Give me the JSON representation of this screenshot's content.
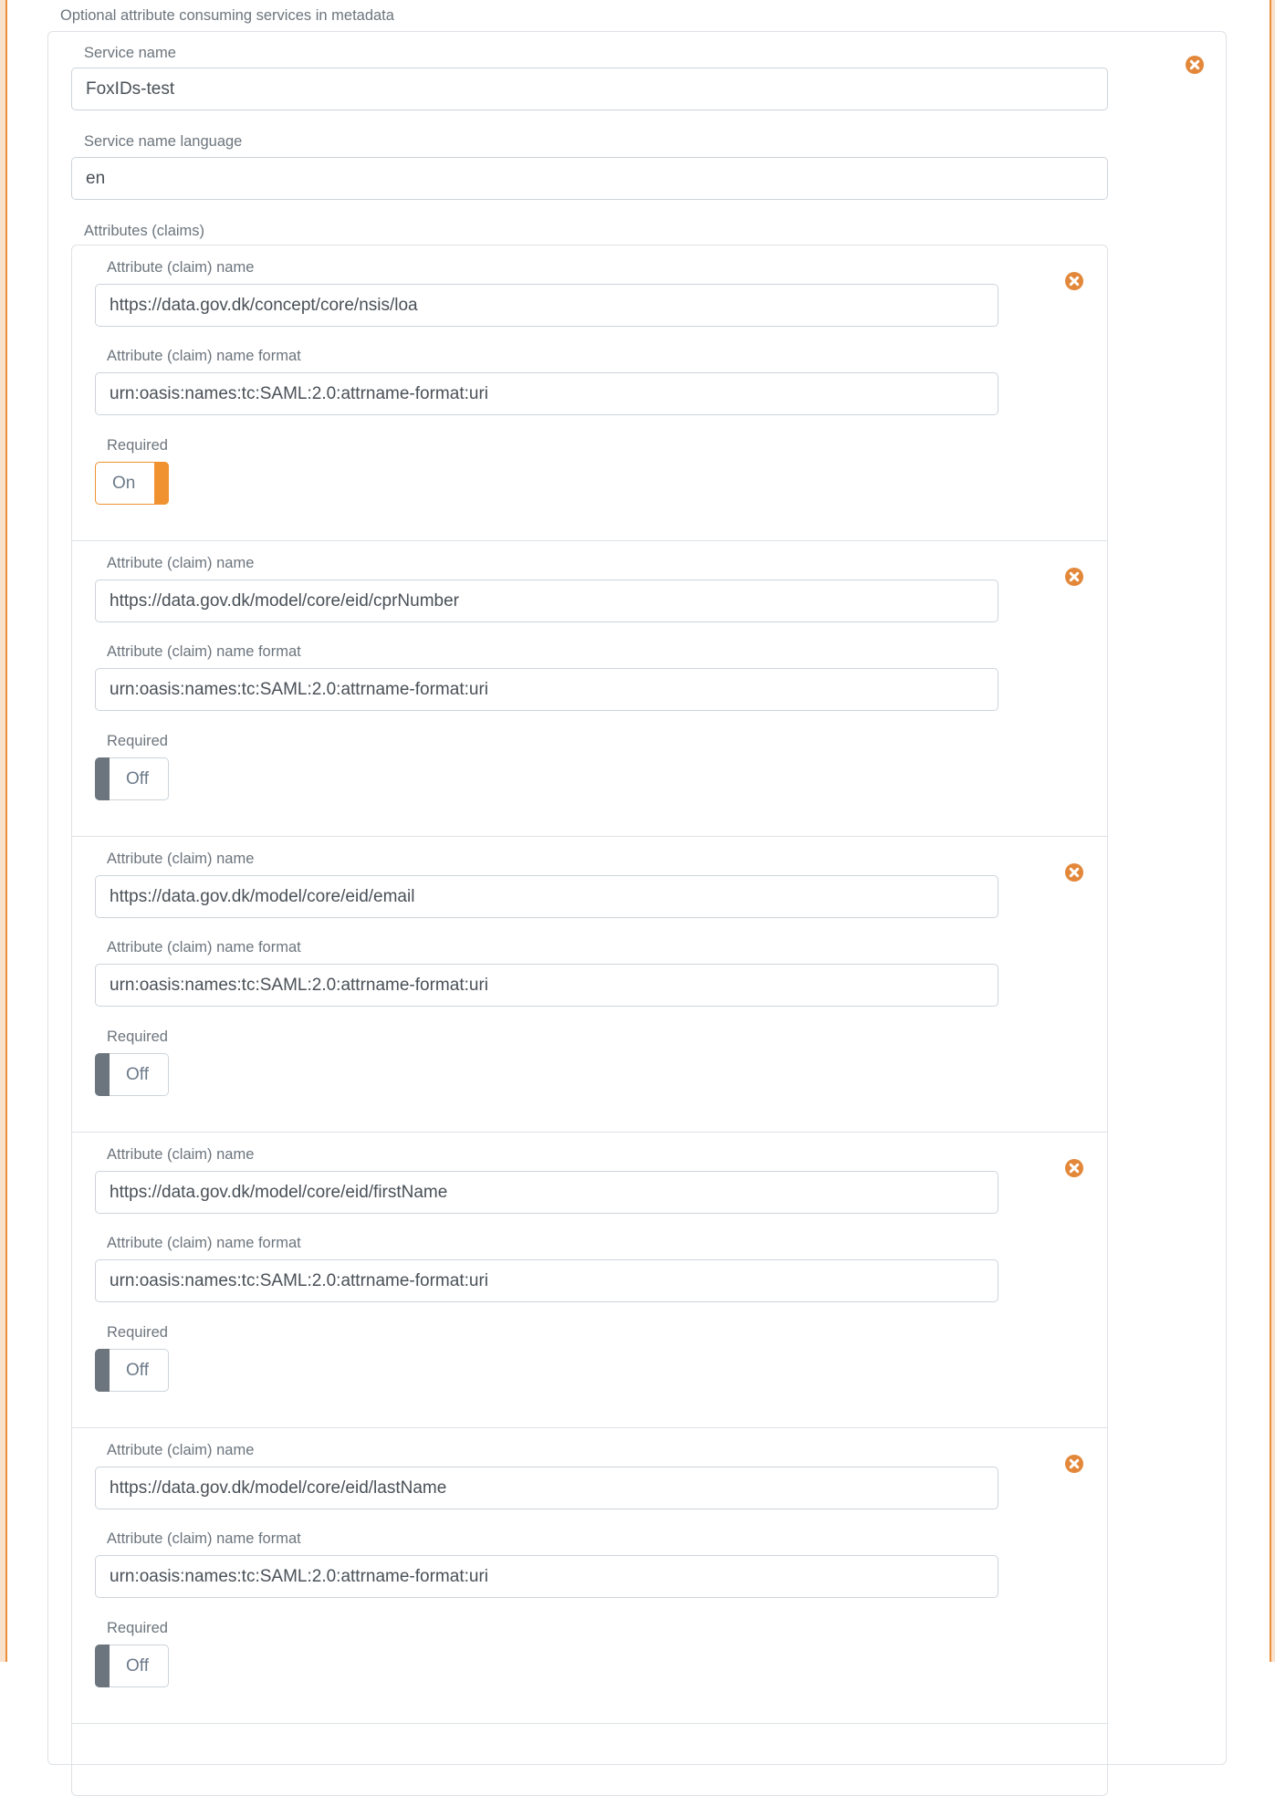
{
  "section": {
    "title": "Optional attribute consuming services in metadata"
  },
  "service": {
    "name_label": "Service name",
    "name_value": "FoxIDs-test",
    "language_label": "Service name language",
    "language_value": "en",
    "attributes_label": "Attributes (claims)",
    "remove_icon": "remove-circle-x-icon"
  },
  "attributes": [
    {
      "name_label": "Attribute (claim) name",
      "name_value": "https://data.gov.dk/concept/core/nsis/loa",
      "format_label": "Attribute (claim) name format",
      "format_value": "urn:oasis:names:tc:SAML:2.0:attrname-format:uri",
      "required_label": "Required",
      "required": true,
      "required_text": "On"
    },
    {
      "name_label": "Attribute (claim) name",
      "name_value": "https://data.gov.dk/model/core/eid/cprNumber",
      "format_label": "Attribute (claim) name format",
      "format_value": "urn:oasis:names:tc:SAML:2.0:attrname-format:uri",
      "required_label": "Required",
      "required": false,
      "required_text": "Off"
    },
    {
      "name_label": "Attribute (claim) name",
      "name_value": "https://data.gov.dk/model/core/eid/email",
      "format_label": "Attribute (claim) name format",
      "format_value": "urn:oasis:names:tc:SAML:2.0:attrname-format:uri",
      "required_label": "Required",
      "required": false,
      "required_text": "Off"
    },
    {
      "name_label": "Attribute (claim) name",
      "name_value": "https://data.gov.dk/model/core/eid/firstName",
      "format_label": "Attribute (claim) name format",
      "format_value": "urn:oasis:names:tc:SAML:2.0:attrname-format:uri",
      "required_label": "Required",
      "required": false,
      "required_text": "Off"
    },
    {
      "name_label": "Attribute (claim) name",
      "name_value": "https://data.gov.dk/model/core/eid/lastName",
      "format_label": "Attribute (claim) name format",
      "format_value": "urn:oasis:names:tc:SAML:2.0:attrname-format:uri",
      "required_label": "Required",
      "required": false,
      "required_text": "Off"
    }
  ],
  "colors": {
    "accent": "#f0922f",
    "remove_icon": "#e3883a",
    "toggle_off_handle": "#6c757d",
    "label_text": "#6c757d",
    "border": "#dee2e6"
  }
}
